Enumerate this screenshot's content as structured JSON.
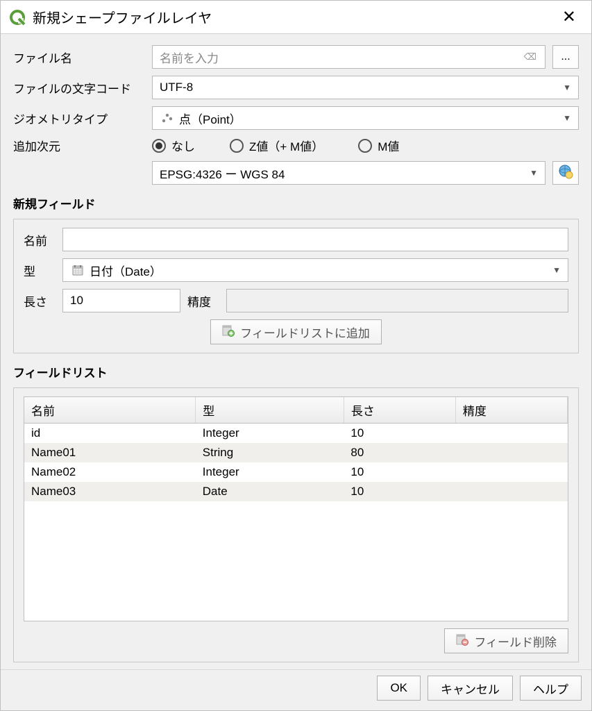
{
  "window": {
    "title": "新規シェープファイルレイヤ"
  },
  "labels": {
    "filename": "ファイル名",
    "encoding": "ファイルの文字コード",
    "geom_type": "ジオメトリタイプ",
    "dimensions": "追加次元",
    "new_field_section": "新規フィールド",
    "name": "名前",
    "type": "型",
    "length": "長さ",
    "precision": "精度",
    "field_list_section": "フィールドリスト"
  },
  "form": {
    "filename_placeholder": "名前を入力",
    "browse_btn": "...",
    "encoding_value": "UTF-8",
    "geom_type_value": "点（Point）",
    "crs_value": "EPSG:4326 ー WGS 84"
  },
  "dimensions": {
    "none": "なし",
    "z": "Z値（+ M値）",
    "m": "M値",
    "selected": "none"
  },
  "new_field": {
    "name_value": "",
    "type_value": "日付（Date）",
    "length_value": "10",
    "precision_value": ""
  },
  "buttons": {
    "add_to_list": "フィールドリストに追加",
    "remove_field": "フィールド削除",
    "ok": "OK",
    "cancel": "キャンセル",
    "help": "ヘルプ"
  },
  "table": {
    "headers": {
      "name": "名前",
      "type": "型",
      "length": "長さ",
      "precision": "精度"
    },
    "rows": [
      {
        "name": "id",
        "type": "Integer",
        "length": "10",
        "precision": ""
      },
      {
        "name": "Name01",
        "type": "String",
        "length": "80",
        "precision": ""
      },
      {
        "name": "Name02",
        "type": "Integer",
        "length": "10",
        "precision": ""
      },
      {
        "name": "Name03",
        "type": "Date",
        "length": "10",
        "precision": ""
      }
    ]
  }
}
